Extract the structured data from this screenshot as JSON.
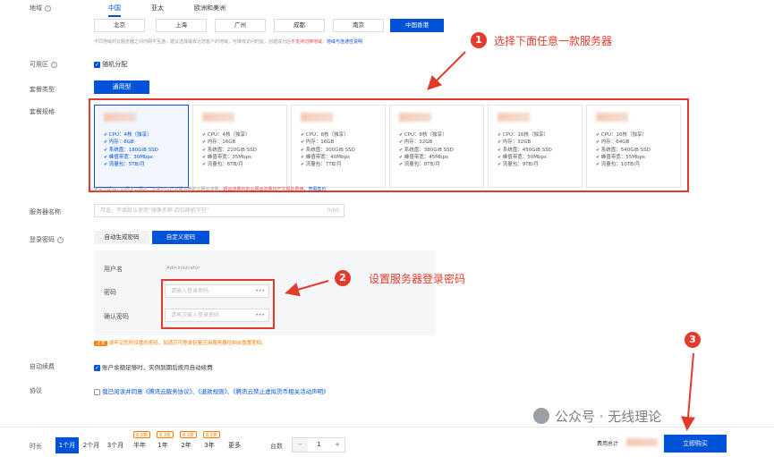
{
  "region": {
    "label": "地域",
    "tabs": [
      "中国",
      "亚太",
      "欧洲和美洲"
    ],
    "cities": [
      "北京",
      "上海",
      "广州",
      "成都",
      "南京",
      "中国香港"
    ],
    "note_prefix": "不同地域的云服务器之间内网不互通，建议选择最靠近您客户的地域，可降低访问时延，创建成功后",
    "note_red": "不支持切换地域",
    "note_link": "地域与连通性说明"
  },
  "zone": {
    "label": "可用区",
    "value": "随机分配"
  },
  "package_type": {
    "label": "套餐类型",
    "value": "通用型"
  },
  "spec": {
    "label": "套餐规格",
    "cards": [
      {
        "lines": [
          "CPU：4核（独享）",
          "内存：8GB",
          "系统盘：180GiB SSD",
          "峰值带宽：30Mbps",
          "流量包：5TB/月"
        ]
      },
      {
        "lines": [
          "CPU：4核（独享）",
          "内存：16GB",
          "系统盘：220GiB SSD",
          "峰值带宽：35Mbps",
          "流量包：6TB/月"
        ]
      },
      {
        "lines": [
          "CPU：8核（独享）",
          "内存：16GB",
          "系统盘：300GiB SSD",
          "峰值带宽：40Mbps",
          "流量包：7TB/月"
        ]
      },
      {
        "lines": [
          "CPU：8核（独享）",
          "内存：32GB",
          "系统盘：380GiB SSD",
          "峰值带宽：45Mbps",
          "流量包：8TB/月"
        ]
      },
      {
        "lines": [
          "CPU：16核（独享）",
          "内存：32GB",
          "系统盘：450GiB SSD",
          "峰值带宽：50Mbps",
          "流量包：9TB/月"
        ]
      },
      {
        "lines": [
          "CPU：16核（独享）",
          "内存：64GB",
          "系统盘：540GiB SSD",
          "峰值带宽：55Mbps",
          "流量包：10TB/月"
        ]
      }
    ],
    "note_prefix": "免费分配独立的固定公网IP，流量包仅针对服务器的公网出流量，",
    "note_red": "超出流量包的公网出流量将产生额外费用",
    "note_link": "，查看售价"
  },
  "server_name": {
    "label": "服务器名称",
    "placeholder": "可选，不填默认使用\"镜像名称-四位随机字符\"",
    "counter": "0/60"
  },
  "login": {
    "label": "登录密码",
    "tabs": [
      "自动生成密码",
      "自定义密码"
    ],
    "username_label": "用户名",
    "username_value": "Administrator",
    "password_label": "密码",
    "password_placeholder": "请输入登录密码",
    "confirm_label": "确认密码",
    "confirm_placeholder": "请再次输入登录密码",
    "warn_tag": "注意",
    "warn_text": "请牢记您所设置的密码，如遗忘可登录轻量应用服务器控制台重置密码。"
  },
  "renew": {
    "label": "自动续费",
    "text": "账户余额足够时，实例到期后按月自动续费"
  },
  "agreement": {
    "label": "协议",
    "text": "我已阅读并同意《腾讯云服务协议》、《退款规则》、《腾讯云禁止虚拟货币相关活动声明》"
  },
  "bottom": {
    "duration_label": "时长",
    "durations": [
      "1个月",
      "2个月",
      "3个月",
      "半年",
      "1年",
      "2年",
      "3年",
      "更多"
    ],
    "discounts": [
      "8.3折",
      "8.3折",
      "8.3折",
      "8.3折"
    ],
    "count_label": "台数",
    "count_value": "1",
    "minus": "−",
    "plus": "+",
    "fee_label": "费用总计",
    "buy_label": "立即购买"
  },
  "annotations": {
    "step1": {
      "num": "1",
      "text": "选择下面任意一款服务器"
    },
    "step2": {
      "num": "2",
      "text": "设置服务器登录密码"
    },
    "step3": {
      "num": "3"
    }
  },
  "watermark": "公众号 · 无线理论",
  "colors": {
    "primary": "#0052d9",
    "annotation": "#e33b2b",
    "warning": "#ff7a00"
  }
}
